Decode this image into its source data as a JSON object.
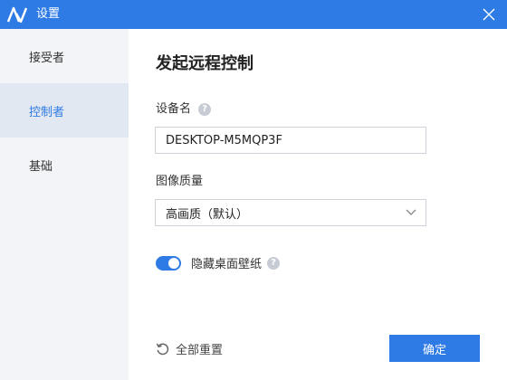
{
  "window": {
    "title": "设置",
    "logo_icon": "app-logo-icon",
    "close_icon": "close-icon",
    "accent_color": "#2f7be5"
  },
  "sidebar": {
    "items": [
      {
        "label": "接受者",
        "active": false
      },
      {
        "label": "控制者",
        "active": true
      },
      {
        "label": "基础",
        "active": false
      }
    ]
  },
  "main": {
    "title": "发起远程控制",
    "device_name": {
      "label": "设备名",
      "value": "DESKTOP-M5MQP3F",
      "help_icon": "?"
    },
    "image_quality": {
      "label": "图像质量",
      "selected": "高画质（默认）"
    },
    "hide_wallpaper": {
      "label": "隐藏桌面壁纸",
      "enabled": true,
      "help_icon": "?"
    },
    "reset_label": "全部重置",
    "confirm_label": "确定"
  }
}
